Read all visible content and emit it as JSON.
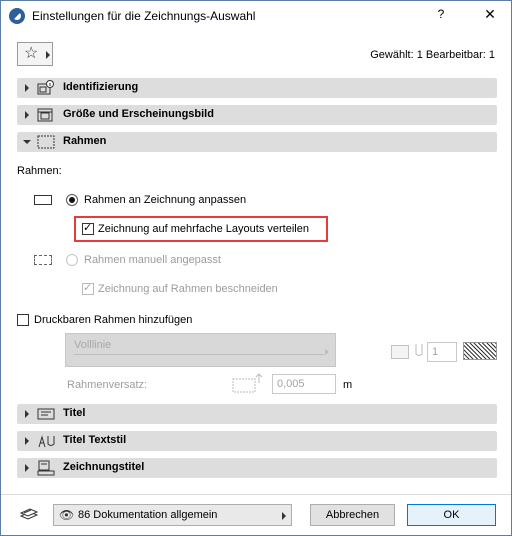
{
  "window": {
    "title": "Einstellungen für die Zeichnungs-Auswahl",
    "help": "?",
    "close": "✕"
  },
  "header": {
    "favorites_icon": "star-icon",
    "selection_info": "Gewählt: 1 Bearbeitbar: 1"
  },
  "panels": [
    {
      "label": "Identifizierung",
      "expanded": false,
      "icon": "info-icon"
    },
    {
      "label": "Größe und Erscheinungsbild",
      "expanded": false,
      "icon": "size-icon"
    },
    {
      "label": "Rahmen",
      "expanded": true,
      "icon": "frame-icon"
    },
    {
      "label": "Titel",
      "expanded": false,
      "icon": "title-icon"
    },
    {
      "label": "Titel Textstil",
      "expanded": false,
      "icon": "text-style-icon"
    },
    {
      "label": "Zeichnungstitel",
      "expanded": false,
      "icon": "drawing-title-icon"
    }
  ],
  "rahmen": {
    "section_label": "Rahmen:",
    "option_fit": {
      "label": "Rahmen an Zeichnung anpassen",
      "selected": true
    },
    "option_distribute": {
      "label": "Zeichnung auf mehrfache Layouts verteilen",
      "checked": true
    },
    "option_manual": {
      "label": "Rahmen manuell angepasst",
      "selected": false
    },
    "option_crop": {
      "label": "Zeichnung auf Rahmen beschneiden",
      "checked": true
    },
    "printable_frame": {
      "label": "Druckbaren Rahmen hinzufügen",
      "checked": false
    },
    "line_type": "Volllinie",
    "pen_value": "1",
    "offset_label": "Rahmenversatz:",
    "offset_value": "0,005",
    "offset_unit": "m"
  },
  "footer": {
    "layer": "86 Dokumentation allgemein",
    "cancel": "Abbrechen",
    "ok": "OK"
  },
  "colors": {
    "highlight": "#e53b3b",
    "panel_bg": "#dddddd",
    "ok_border": "#0078d7"
  }
}
